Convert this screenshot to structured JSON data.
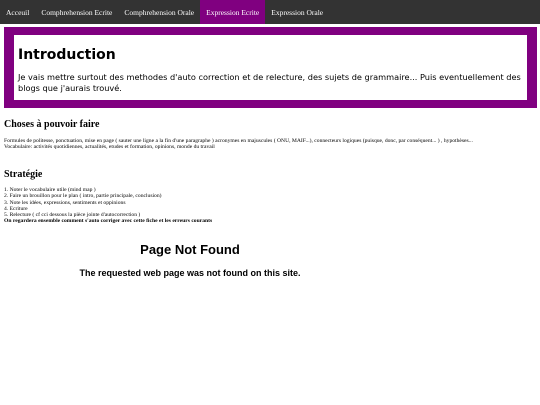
{
  "nav": {
    "items": [
      {
        "label": "Acceuil"
      },
      {
        "label": "Comphrehension Ecrite"
      },
      {
        "label": "Comphrehension Orale"
      },
      {
        "label": "Expression Ecrite"
      },
      {
        "label": "Expression Orale"
      }
    ],
    "active_index": 3
  },
  "hero": {
    "title": "Introduction",
    "text": "Je vais mettre surtout des methodes d'auto correction et de relecture, des sujets de grammaire... Puis eventuellement des blogs que j'aurais trouvé."
  },
  "choses": {
    "heading": "Choses à pouvoir faire",
    "line1": "Formules de politesse, ponctuation, mise en page ( sauter une ligne a la fin d'une paragraphe ) acronymes en majuscules ( ONU, MAIF...), connecteurs logiques (puisque, donc, par conséquent... ) , hypothèses...",
    "line2": "Vocabulaire: activités quotidiennes, actualités, etudes et formation, opinions, monde du travail"
  },
  "strategie": {
    "heading": "Stratégie",
    "steps": [
      "1. Noter le vocabulaire utile (mind map )",
      "2. Faire un brouillon pour le plan ( intro, partie principale, conclusion)",
      "3. Note les idées, expressions, sentiments et oppinions",
      "4. Ecriture",
      "5. Relecture ( cf cci dessous la pièce jointe d'autocorrection )"
    ],
    "note": "On regardera ensemble comment s'auto corriger avec cette fiche et les erreurs courants"
  },
  "not_found": {
    "title": "Page Not Found",
    "message": "The requested web page was not found on this site."
  },
  "colors": {
    "nav_bg": "#333333",
    "accent": "#800080",
    "text": "#000000"
  }
}
